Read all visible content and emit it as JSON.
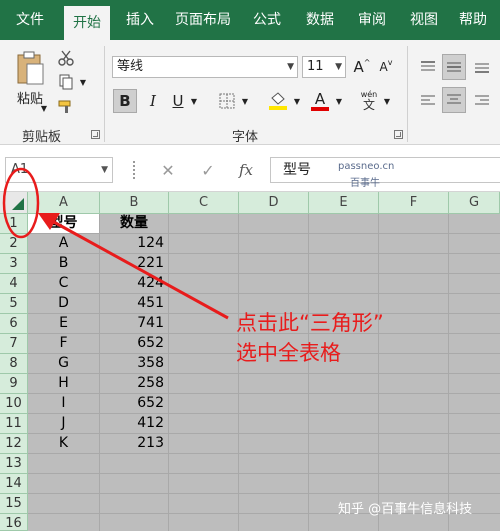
{
  "ribbon_tabs": [
    "文件",
    "开始",
    "插入",
    "页面布局",
    "公式",
    "数据",
    "审阅",
    "视图",
    "帮助"
  ],
  "clipboard": {
    "paste_label": "粘贴",
    "group_label": "剪贴板"
  },
  "font": {
    "family": "等线",
    "size": "11",
    "grow_label": "A",
    "shrink_label": "A",
    "bold_label": "B",
    "italic_label": "I",
    "underline_label": "U",
    "font_color_label": "A",
    "phonetic_label": "wén",
    "group_label": "字体"
  },
  "formula_bar": {
    "name_box": "A1",
    "cancel_label": "✕",
    "enter_label": "✓",
    "fx_label": "fx",
    "content": "型号"
  },
  "watermark_site": {
    "line1": "passneo.cn",
    "line2": "百事牛"
  },
  "columns": [
    "A",
    "B",
    "C",
    "D",
    "E",
    "F",
    "G"
  ],
  "rows": [
    "1",
    "2",
    "3",
    "4",
    "5",
    "6",
    "7",
    "8",
    "9",
    "10",
    "11",
    "12",
    "13",
    "14",
    "15",
    "16"
  ],
  "table": {
    "headers": [
      "型号",
      "数量"
    ],
    "data": [
      [
        "A",
        "124"
      ],
      [
        "B",
        "221"
      ],
      [
        "C",
        "424"
      ],
      [
        "D",
        "451"
      ],
      [
        "E",
        "741"
      ],
      [
        "F",
        "652"
      ],
      [
        "G",
        "358"
      ],
      [
        "H",
        "258"
      ],
      [
        "I",
        "652"
      ],
      [
        "J",
        "412"
      ],
      [
        "K",
        "213"
      ]
    ]
  },
  "annotation": {
    "line1": "点击此“三角形”",
    "line2": "选中全表格"
  },
  "watermark": "知乎 @百事牛信息科技",
  "colors": {
    "excel_green": "#217346",
    "annotation_red": "#e81c1c",
    "selection_gray": "#bdbdbd"
  }
}
